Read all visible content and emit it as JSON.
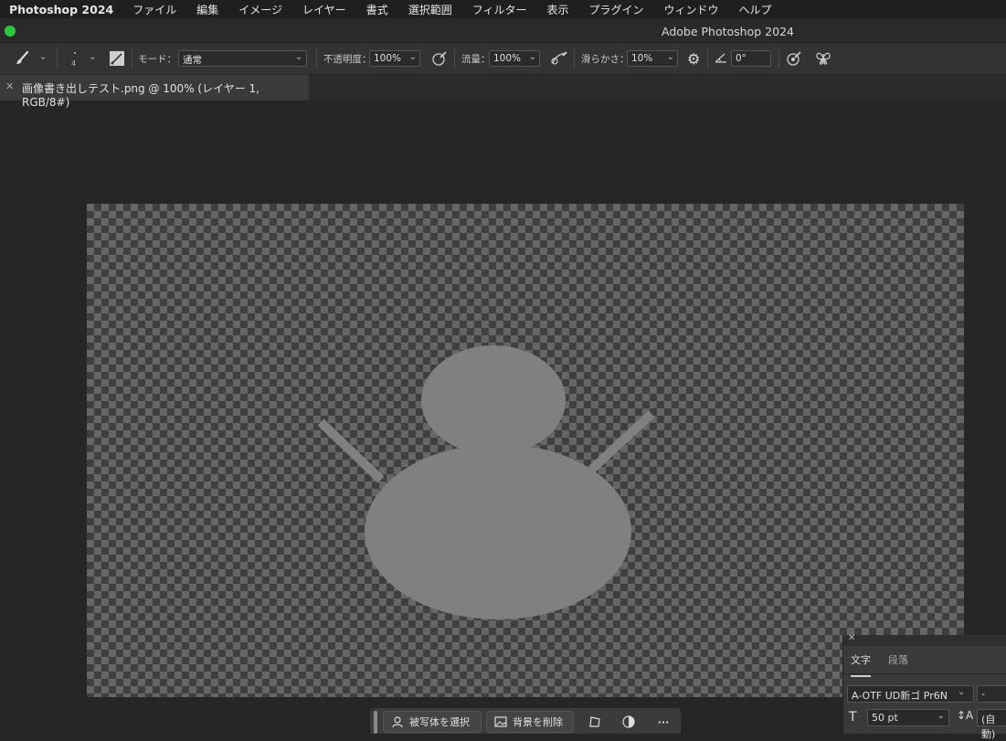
{
  "menubar": {
    "app": "Photoshop 2024",
    "items": [
      "ファイル",
      "編集",
      "イメージ",
      "レイヤー",
      "書式",
      "選択範囲",
      "フィルター",
      "表示",
      "プラグイン",
      "ウィンドウ",
      "ヘルプ"
    ]
  },
  "window": {
    "title": "Adobe Photoshop 2024"
  },
  "options": {
    "brush_size": "4",
    "mode_label": "モード：",
    "mode_value": "通常",
    "opacity_label": "不透明度：",
    "opacity_value": "100%",
    "flow_label": "流量：",
    "flow_value": "100%",
    "smoothing_label": "滑らかさ：",
    "smoothing_value": "10%",
    "angle_value": "0°"
  },
  "document": {
    "tab_title": "画像書き出しテスト.png @ 100% (レイヤー 1, RGB/8#)"
  },
  "context_bar": {
    "select_subject": "被写体を選択",
    "remove_background": "背景を削除",
    "more": "···"
  },
  "char_panel": {
    "tab_character": "文字",
    "tab_paragraph": "段落",
    "font_family": "A-OTF UD新ゴ Pr6N",
    "font_style": "-",
    "font_size": "50 pt",
    "leading": "(自動)"
  },
  "colors": {
    "accent_green": "#2ac840",
    "figure": "#808080"
  }
}
